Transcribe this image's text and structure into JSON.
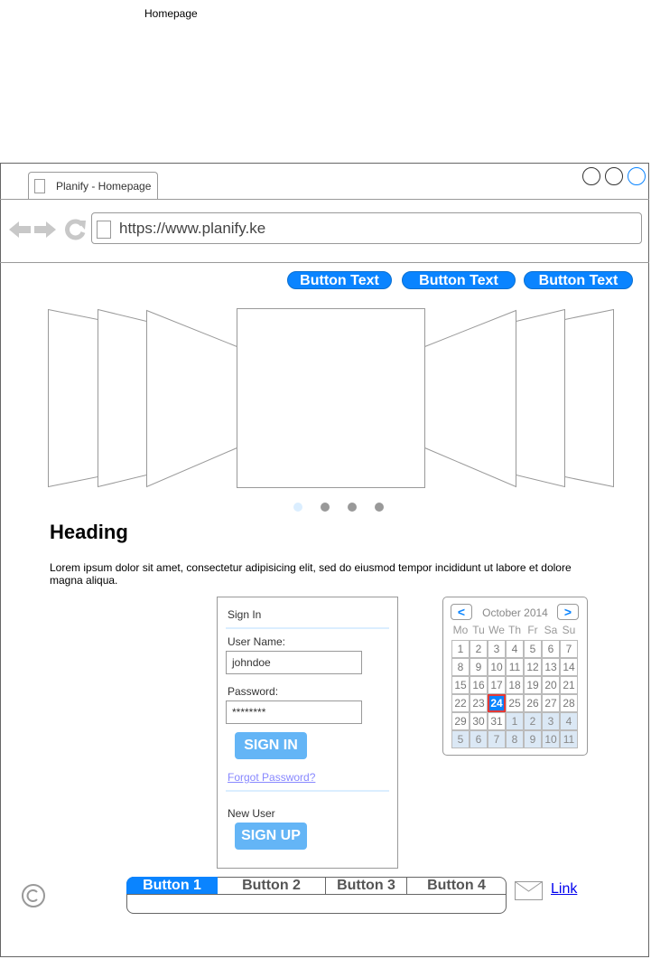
{
  "page": {
    "label": "Homepage"
  },
  "browser": {
    "tab_title": "Planify - Homepage",
    "url": "https://www.planify.ke"
  },
  "nav": {
    "buttons": [
      "Button Text",
      "Button Text",
      "Button Text"
    ]
  },
  "carousel": {
    "dot_count": 4,
    "active_dot": 0
  },
  "content": {
    "heading": "Heading",
    "paragraph": "Lorem ipsum dolor sit amet, consectetur adipisicing elit, sed do eiusmod tempor incididunt ut labore et dolore magna aliqua."
  },
  "signin": {
    "title": "Sign In",
    "username_label": "User Name:",
    "username_value": "johndoe",
    "password_label": "Password:",
    "password_value": "********",
    "signin_button": "SIGN IN",
    "forgot_link": "Forgot Password?",
    "new_user_label": "New User",
    "signup_button": "SIGN UP"
  },
  "calendar": {
    "prev": "<",
    "next": ">",
    "month_label": "October 2014",
    "weekdays": [
      "Mo",
      "Tu",
      "We",
      "Th",
      "Fr",
      "Sa",
      "Su"
    ],
    "weeks": [
      [
        "1",
        "2",
        "3",
        "4",
        "5",
        "6",
        "7"
      ],
      [
        "8",
        "9",
        "10",
        "11",
        "12",
        "13",
        "14"
      ],
      [
        "15",
        "16",
        "17",
        "18",
        "19",
        "20",
        "21"
      ],
      [
        "22",
        "23",
        "24",
        "25",
        "26",
        "27",
        "28"
      ],
      [
        "29",
        "30",
        "31",
        "1",
        "2",
        "3",
        "4"
      ],
      [
        "5",
        "6",
        "7",
        "8",
        "9",
        "10",
        "11"
      ]
    ],
    "selected_day": "24"
  },
  "bottom_bar": {
    "buttons": [
      "Button 1",
      "Button 2",
      "Button 3",
      "Button 4"
    ],
    "active_index": 0
  },
  "footer": {
    "link": "Link"
  },
  "colors": {
    "accent": "#0a84ff",
    "soft_button": "#64b5f6",
    "selected_border": "#e53935"
  }
}
